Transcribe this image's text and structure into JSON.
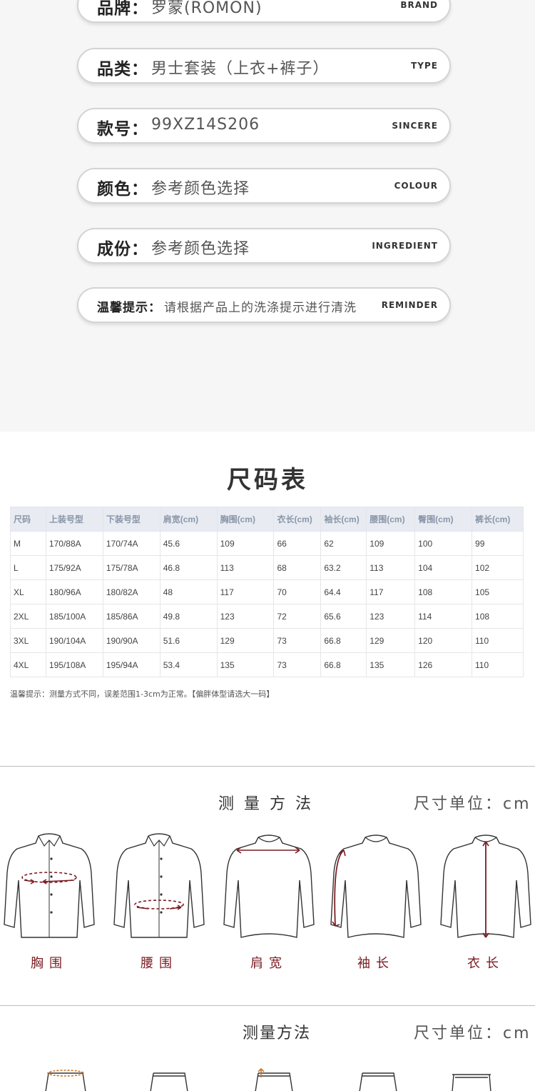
{
  "info": {
    "brand": {
      "label": "品牌：",
      "value": "罗蒙(ROMON)",
      "tag": "BRAND"
    },
    "type": {
      "label": "品类：",
      "value": "男士套装（上衣+裤子）",
      "tag": "TYPE"
    },
    "style_no": {
      "label": "款号：",
      "value": "99XZ14S206",
      "tag": "SINCERE"
    },
    "colour": {
      "label": "颜色：",
      "value": "参考颜色选择",
      "tag": "COLOUR"
    },
    "ingredient": {
      "label": "成份：",
      "value": "参考颜色选择",
      "tag": "INGREDIENT"
    },
    "reminder": {
      "label": "温馨提示：",
      "value": "请根据产品上的洗涤提示进行清洗",
      "tag": "REMINDER"
    }
  },
  "size_chart": {
    "title": "尺码表",
    "headers": [
      "尺码",
      "上装号型",
      "下装号型",
      "肩宽(cm)",
      "胸围(cm)",
      "衣长(cm)",
      "袖长(cm)",
      "腰围(cm)",
      "臀围(cm)",
      "裤长(cm)"
    ],
    "rows": [
      [
        "M",
        "170/88A",
        "170/74A",
        "45.6",
        "109",
        "66",
        "62",
        "109",
        "100",
        "99"
      ],
      [
        "L",
        "175/92A",
        "175/78A",
        "46.8",
        "113",
        "68",
        "63.2",
        "113",
        "104",
        "102"
      ],
      [
        "XL",
        "180/96A",
        "180/82A",
        "48",
        "117",
        "70",
        "64.4",
        "117",
        "108",
        "105"
      ],
      [
        "2XL",
        "185/100A",
        "185/86A",
        "49.8",
        "123",
        "72",
        "65.6",
        "123",
        "114",
        "108"
      ],
      [
        "3XL",
        "190/104A",
        "190/90A",
        "51.6",
        "129",
        "73",
        "66.8",
        "129",
        "120",
        "110"
      ],
      [
        "4XL",
        "195/108A",
        "195/94A",
        "53.4",
        "135",
        "73",
        "66.8",
        "135",
        "126",
        "110"
      ]
    ],
    "tip": "温馨提示：测量方式不同，误差范围1-3cm为正常。【偏胖体型请选大一码】"
  },
  "measure_top": {
    "title": "测量方法",
    "unit": "尺寸单位：cm",
    "labels": [
      "胸围",
      "腰围",
      "肩宽",
      "袖长",
      "衣长"
    ]
  },
  "measure_bottom": {
    "title": "测量方法",
    "unit": "尺寸单位：cm"
  },
  "colors": {
    "accent": "#7a1c22",
    "pill_border": "#d4d4d4",
    "bg_gray": "#f6f6f6"
  }
}
